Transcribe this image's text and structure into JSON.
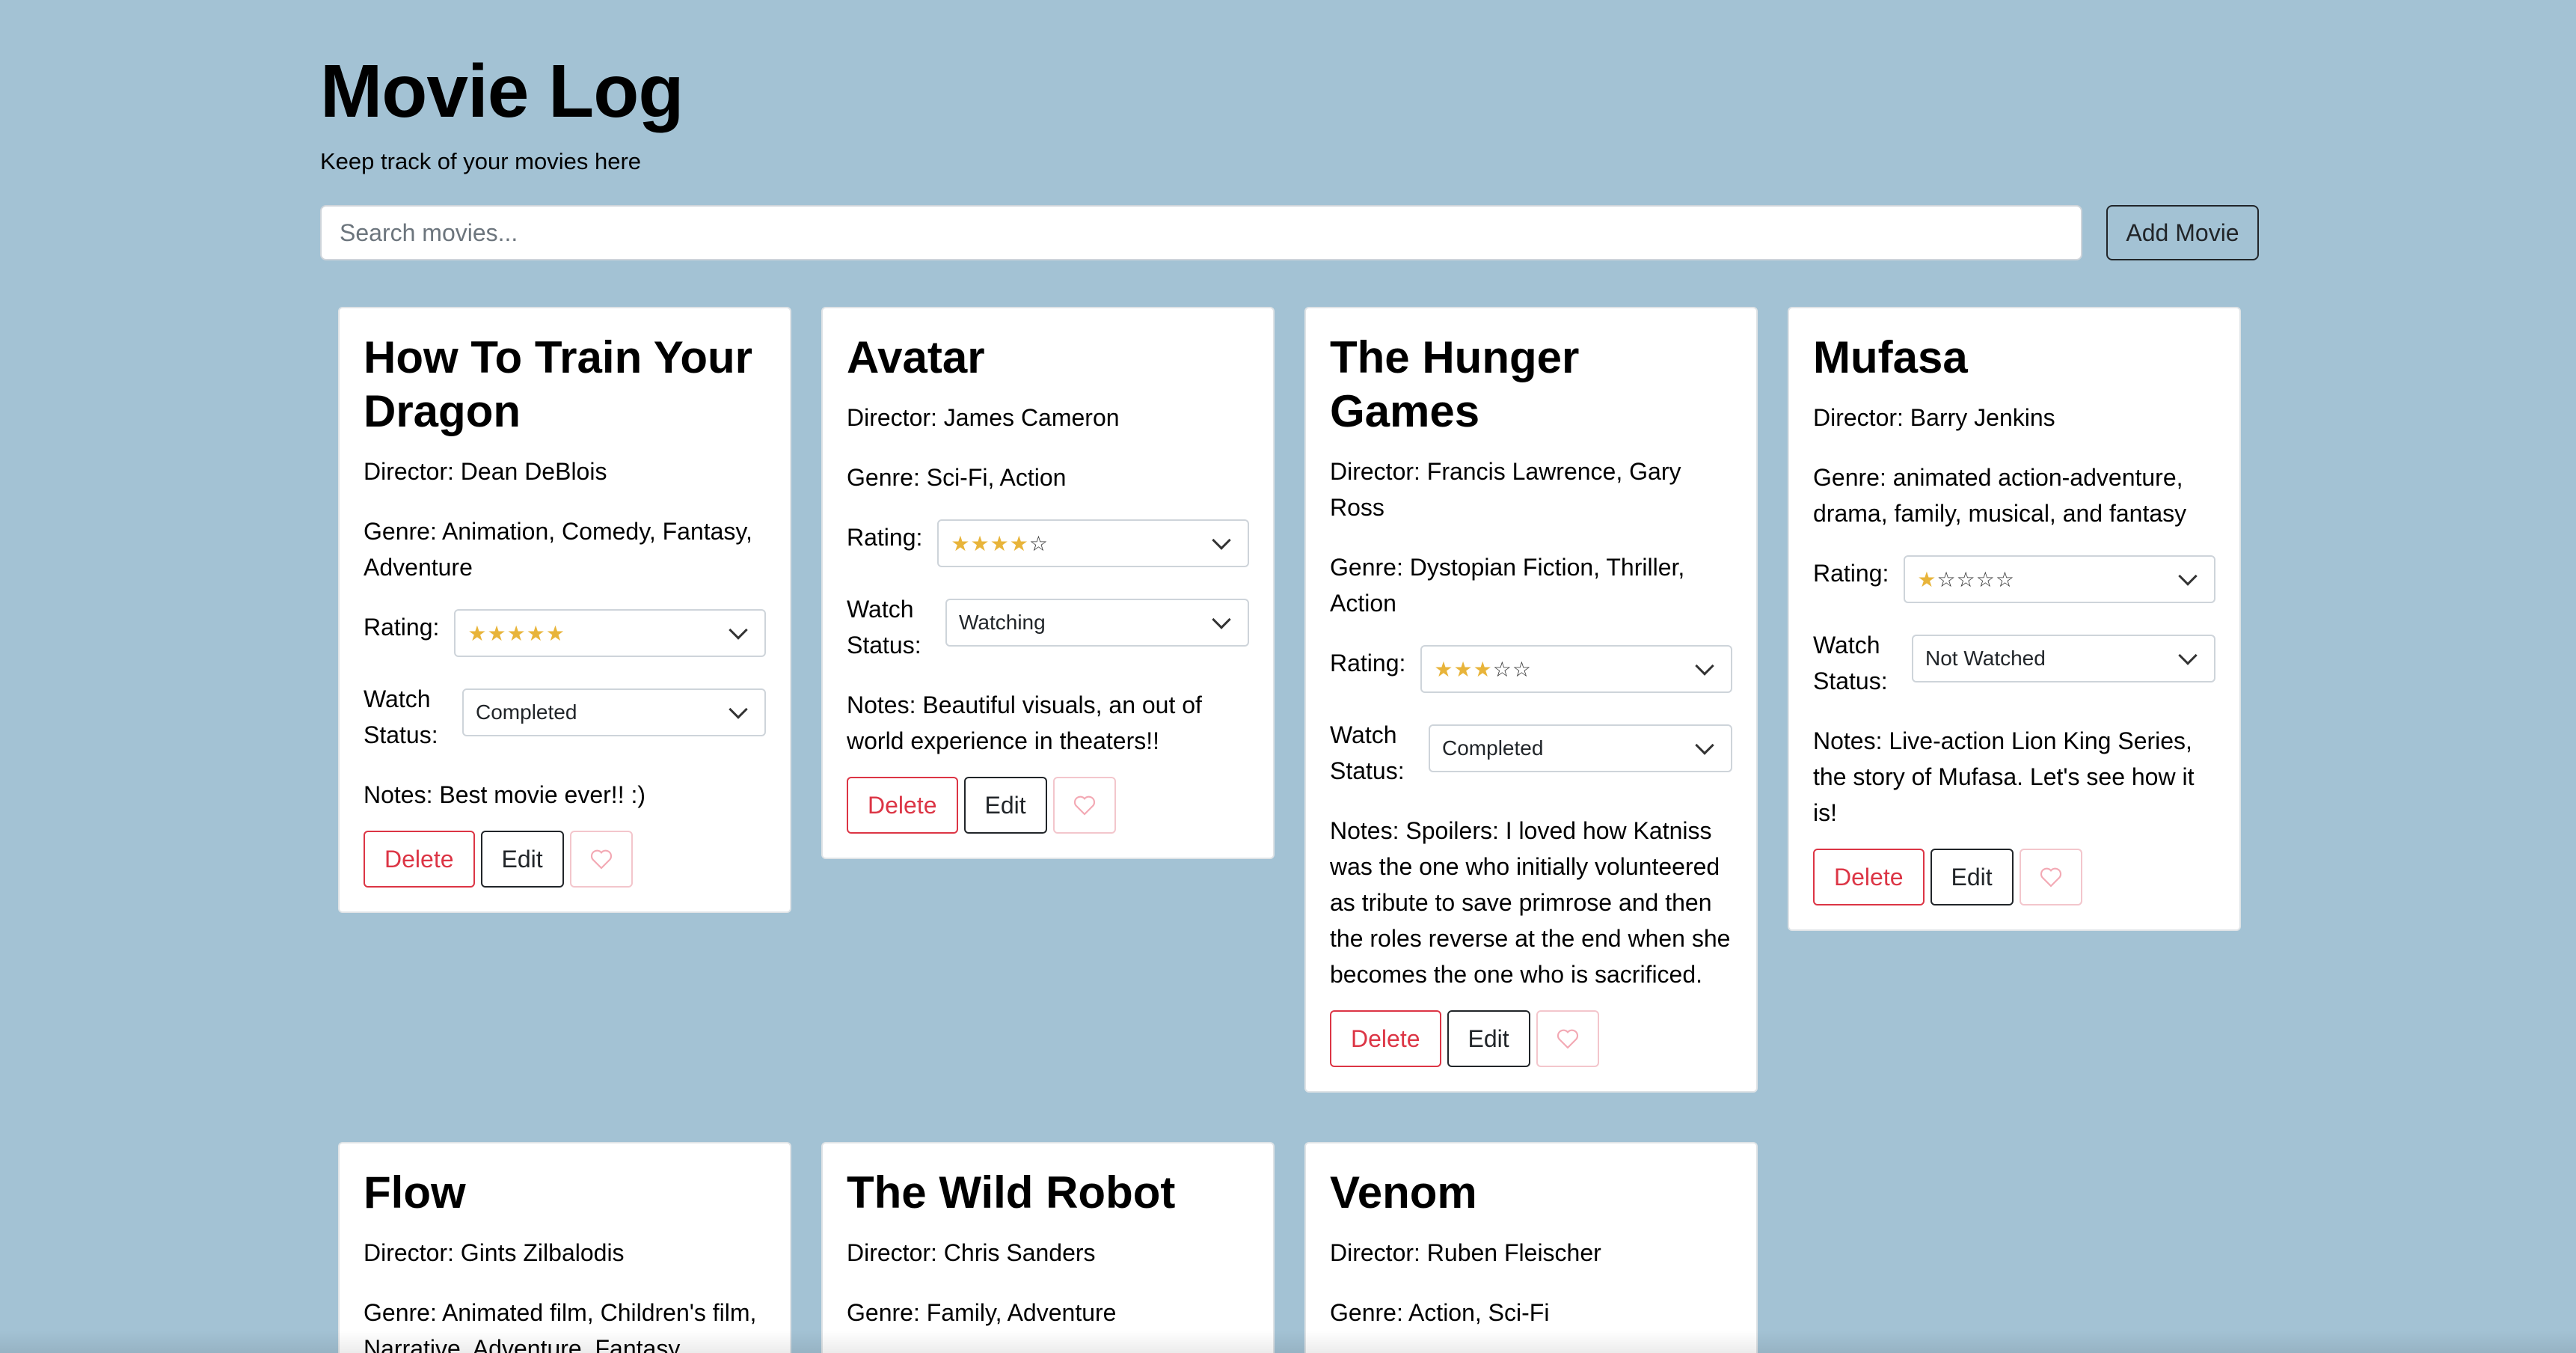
{
  "header": {
    "title": "Movie Log",
    "subtitle": "Keep track of your movies here"
  },
  "search": {
    "placeholder": "Search movies...",
    "value": ""
  },
  "toolbar": {
    "add_label": "Add Movie"
  },
  "labels": {
    "rating": "Rating:",
    "watch_status": "Watch Status:",
    "delete": "Delete",
    "edit": "Edit"
  },
  "colors": {
    "background": "#a3c2d4",
    "delete": "#dc3545",
    "star": "#e8b43a",
    "heart": "#f3a9b4"
  },
  "movies": [
    {
      "title": "How To Train Your Dragon",
      "director": "Director: Dean DeBlois",
      "genre": "Genre: Animation, Comedy, Fantasy, Adventure",
      "rating": 5,
      "status": "Completed",
      "notes": "Notes: Best movie ever!! :)"
    },
    {
      "title": "Avatar",
      "director": "Director: James Cameron",
      "genre": "Genre: Sci-Fi, Action",
      "rating": 4,
      "status": "Watching",
      "notes": "Notes: Beautiful visuals, an out of world experience in theaters!!"
    },
    {
      "title": "The Hunger Games",
      "director": "Director: Francis Lawrence, Gary Ross",
      "genre": "Genre: Dystopian Fiction, Thriller, Action",
      "rating": 3,
      "status": "Completed",
      "notes": "Notes: Spoilers: I loved how Katniss was the one who initially volunteered as tribute to save primrose and then the roles reverse at the end when she becomes the one who is sacrificed."
    },
    {
      "title": "Mufasa",
      "director": "Director: Barry Jenkins",
      "genre": "Genre: animated action-adventure, drama, family, musical, and fantasy",
      "rating": 1,
      "status": "Not Watched",
      "notes": "Notes: Live-action Lion King Series, the story of Mufasa. Let's see how it is!"
    },
    {
      "title": "Flow",
      "director": "Director: Gints Zilbalodis",
      "genre": "Genre: Animated film, Children's film, Narrative, Adventure, Fantasy"
    },
    {
      "title": "The Wild Robot",
      "director": "Director: Chris Sanders",
      "genre": "Genre: Family, Adventure"
    },
    {
      "title": "Venom",
      "director": "Director: Ruben Fleischer",
      "genre": "Genre: Action, Sci-Fi"
    }
  ]
}
